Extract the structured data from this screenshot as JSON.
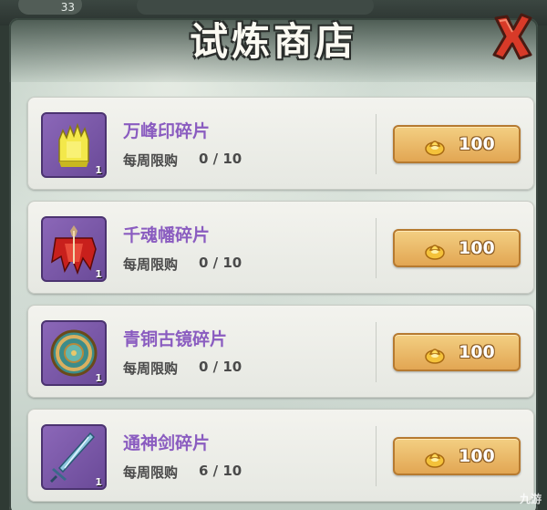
{
  "hud": {
    "value": "33"
  },
  "shop": {
    "title": "试炼商店"
  },
  "items": [
    {
      "name": "万峰印碎片",
      "limit_label": "每周限购",
      "limit_count": "0 / 10",
      "quantity": "1",
      "price": "100",
      "icon": "yellow-seal-icon"
    },
    {
      "name": "千魂幡碎片",
      "limit_label": "每周限购",
      "limit_count": "0 / 10",
      "quantity": "1",
      "price": "100",
      "icon": "red-banner-icon"
    },
    {
      "name": "青铜古镜碎片",
      "limit_label": "每周限购",
      "limit_count": "0 / 10",
      "quantity": "1",
      "price": "100",
      "icon": "bronze-mirror-icon"
    },
    {
      "name": "通神剑碎片",
      "limit_label": "每周限购",
      "limit_count": "6 / 10",
      "quantity": "1",
      "price": "100",
      "icon": "blue-sword-icon"
    }
  ],
  "currency_icon": "gold-ingot-icon",
  "colors": {
    "item_name": "#8a5cc0",
    "buy_button": "#e8b560",
    "icon_frame": "#7a58a8",
    "close": "#d23a2a"
  },
  "watermark": "九游"
}
